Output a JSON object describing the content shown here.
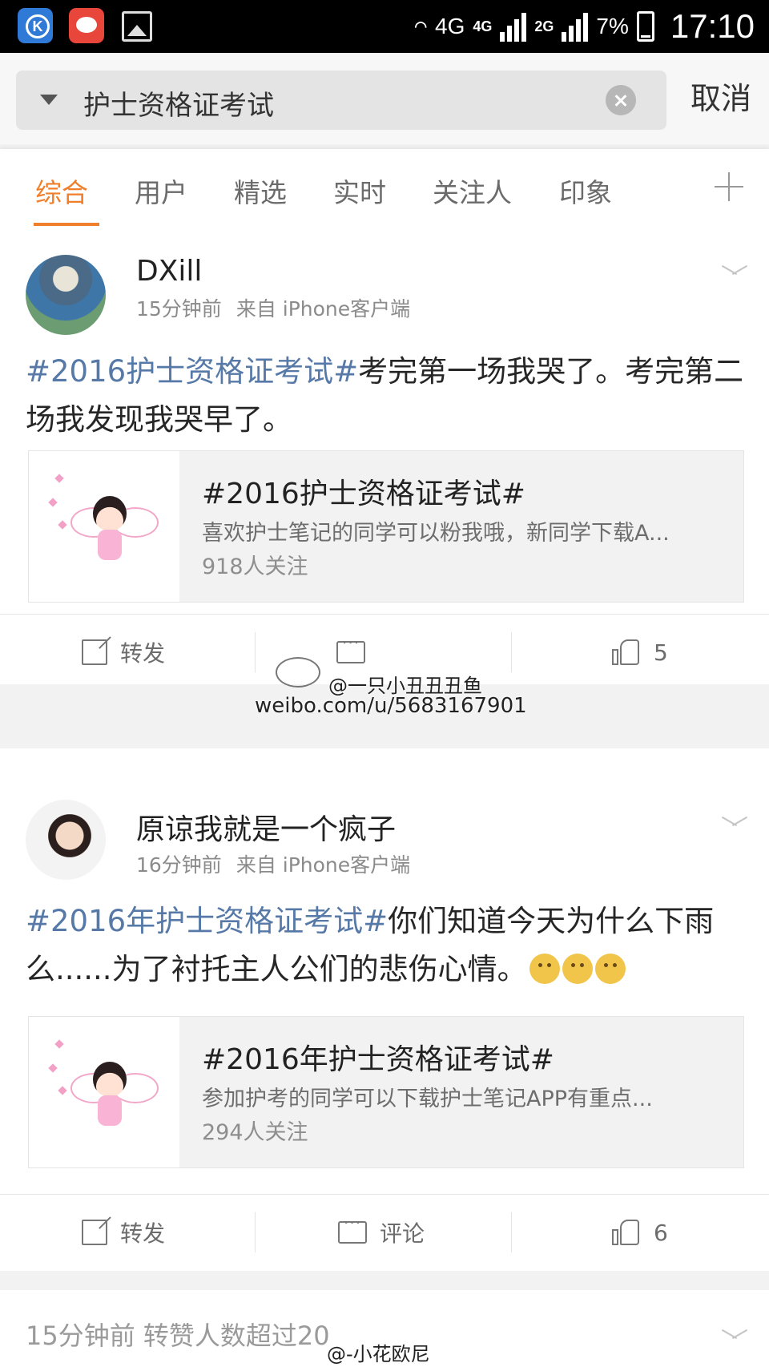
{
  "status_bar": {
    "network_a": "4G",
    "network_b": "4G",
    "network_c": "2G",
    "battery": "7%",
    "time": "17:10"
  },
  "search": {
    "query": "护士资格证考试",
    "cancel_label": "取消"
  },
  "tabs": [
    "综合",
    "用户",
    "精选",
    "实时",
    "关注人",
    "印象"
  ],
  "posts": [
    {
      "username": "DXill",
      "time": "15分钟前",
      "source": "来自 iPhone客户端",
      "hashtag": "#2016护士资格证考试#",
      "text": "考完第一场我哭了。考完第二场我发现我哭早了。",
      "topic": {
        "title": "#2016护士资格证考试#",
        "desc": "喜欢护士笔记的同学可以粉我哦，新同学下载A...",
        "followers": "918人关注"
      },
      "repost_label": "转发",
      "comment_label": "评论",
      "like_count": "5"
    },
    {
      "username": "原谅我就是一个疯子",
      "time": "16分钟前",
      "source": "来自 iPhone客户端",
      "hashtag": "#2016年护士资格证考试#",
      "text": "你们知道今天为什么下雨么......为了衬托主人公们的悲伤心情。",
      "topic": {
        "title": "#2016年护士资格证考试#",
        "desc": "参加护考的同学可以下载护士笔记APP有重点...",
        "followers": "294人关注"
      },
      "repost_label": "转发",
      "comment_label": "评论",
      "like_count": "6"
    }
  ],
  "footer_notice": "15分钟前 转赞人数超过20",
  "watermarks": {
    "handle": "@一只小丑丑丑鱼",
    "url": "weibo.com/u/5683167901",
    "bottom": "@-小花欧尼"
  },
  "colors": {
    "accent": "#f07f2b",
    "hashtag": "#5679a8"
  }
}
